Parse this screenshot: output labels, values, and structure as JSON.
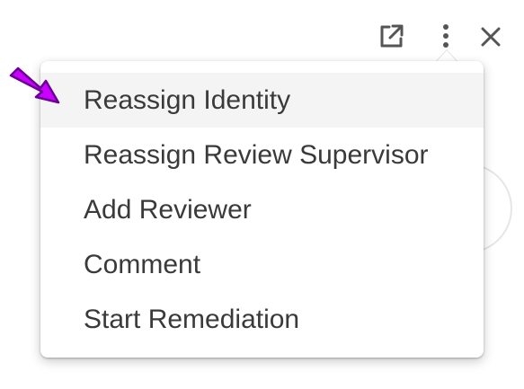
{
  "toolbar": {
    "icons": [
      "external-link-icon",
      "more-vertical-icon",
      "close-icon"
    ]
  },
  "menu": {
    "items": [
      {
        "label": "Reassign Identity",
        "highlighted": true
      },
      {
        "label": "Reassign Review Supervisor",
        "highlighted": false
      },
      {
        "label": "Add Reviewer",
        "highlighted": false
      },
      {
        "label": "Comment",
        "highlighted": false
      },
      {
        "label": "Start Remediation",
        "highlighted": false
      }
    ]
  },
  "colors": {
    "menu_text": "#3a3a3a",
    "highlight_bg": "#f4f4f4",
    "icon": "#555555",
    "annotation_arrow_fill": "#cc00ff",
    "annotation_arrow_stroke": "#6a0095"
  }
}
